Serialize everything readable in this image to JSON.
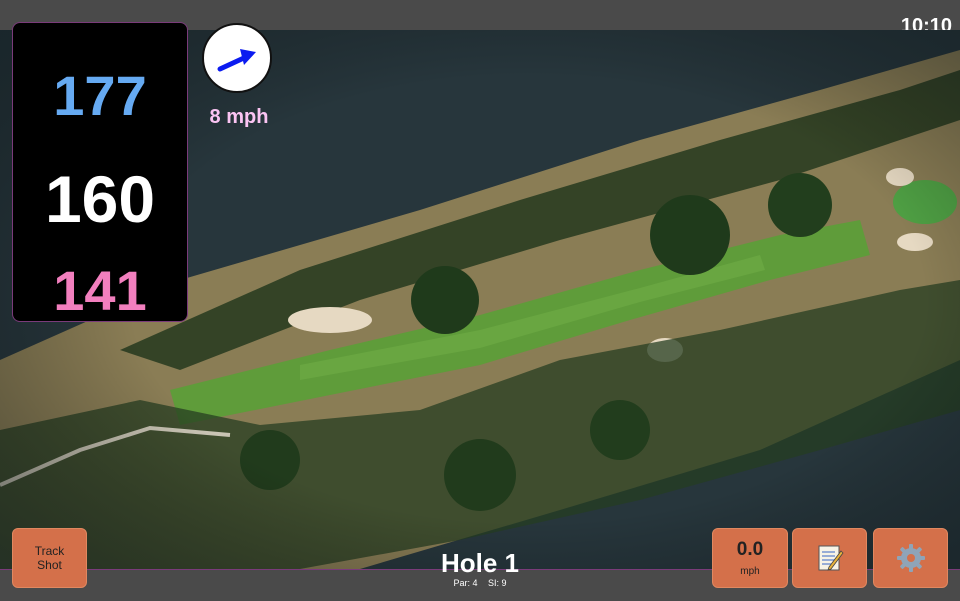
{
  "status": {
    "time": "10:10"
  },
  "distances": {
    "back": "177",
    "middle": "160",
    "front": "141"
  },
  "wind": {
    "speed": "8 mph",
    "direction": "east-northeast",
    "arrow_color": "#0b1bf0"
  },
  "hole": {
    "title": "Hole 1",
    "par_label": "Par: 4",
    "si_label": "SI: 9"
  },
  "buttons": {
    "track_line1": "Track",
    "track_line2": "Shot",
    "speed_value": "0.0",
    "speed_unit": "mph",
    "notes_icon": "notepad-icon",
    "settings_icon": "gear-icon"
  },
  "colors": {
    "back": "#66aaf2",
    "middle": "#ffffff",
    "front": "#f27fbe",
    "button": "#d4704a",
    "accent_border": "#7a3b7a"
  }
}
